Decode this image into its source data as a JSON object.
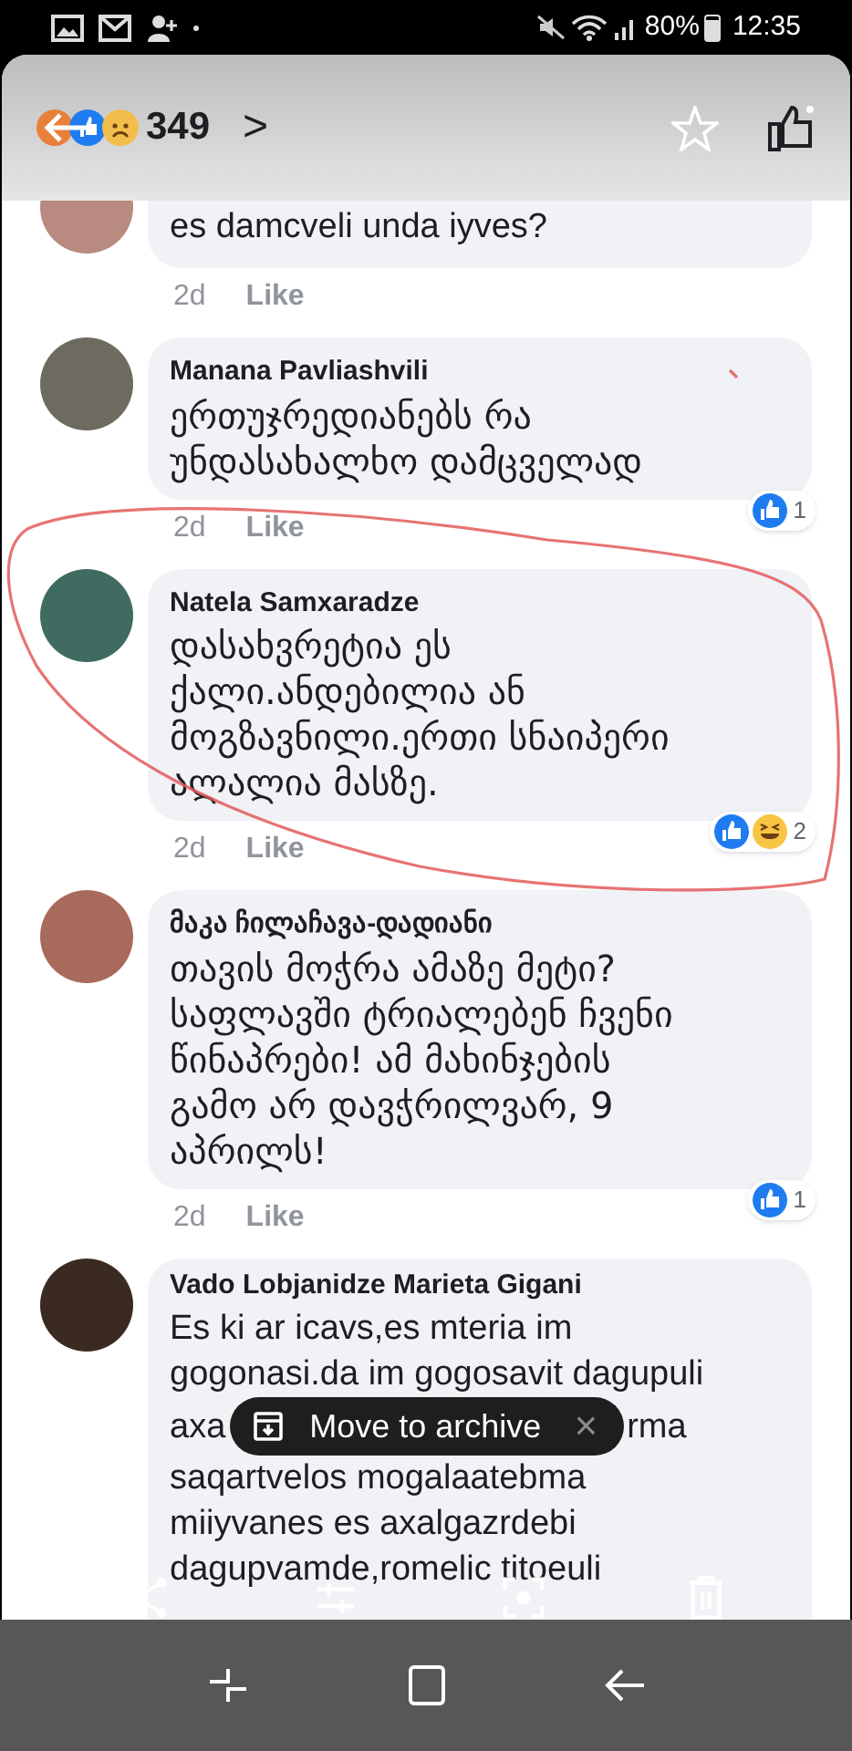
{
  "status_bar": {
    "battery": "80%",
    "time": "12:35"
  },
  "header": {
    "reaction_count": "349",
    "chevron": ">"
  },
  "comments": [
    {
      "lines": [
        [
          "es damcveli unda iyves?"
        ]
      ],
      "time": "2d",
      "like": "Like",
      "cut": true
    },
    {
      "author": "Manana Pavliashvili",
      "lines": [
        [
          "ერთუჯრედიანებს რა"
        ],
        [
          "უნდასახალხო დამცველად"
        ]
      ],
      "time": "2d",
      "like": "Like",
      "reactions": [
        {
          "kind": "like"
        }
      ],
      "count": "1"
    },
    {
      "author": "Natela Samxaradze",
      "lines": [
        [
          "დასახვრეტია ეს"
        ],
        [
          "ქალი.ანდებილია ან"
        ],
        [
          "მოგზავნილი.ერთი სნაიპერი"
        ],
        [
          "ალალია მასზე."
        ]
      ],
      "time": "2d",
      "like": "Like",
      "reactions": [
        {
          "kind": "like"
        },
        {
          "kind": "haha"
        }
      ],
      "count": "2"
    },
    {
      "author": "მაკა ჩილაჩავა-დადიანი",
      "lines": [
        [
          "თავის მოჭრა ამაზე მეტი?"
        ],
        [
          "საფლავში ტრიალებენ ჩვენი"
        ],
        [
          "წინაპრები! ამ მახინჯების"
        ],
        [
          "გამო არ დავჭრილვარ, 9"
        ],
        [
          "აპრილს!"
        ]
      ],
      "time": "2d",
      "like": "Like",
      "reactions": [
        {
          "kind": "like"
        }
      ],
      "count": "1"
    },
    {
      "author": "Vado Lobjanidze Marieta Gigani",
      "lines": [
        [
          "Es ki ar icavs,es mteria im"
        ],
        [
          "gogonasi.da im gogosavit dagupuli"
        ],
        [
          "axa",
          "rma"
        ],
        [
          "saqartvelos mogalaatebma"
        ],
        [
          "miiyvanes es axalgazrdebi"
        ],
        [
          "dagupvamde,romelic titoeuli"
        ]
      ]
    }
  ],
  "toast": {
    "text": "Move to archive",
    "close": "×"
  }
}
